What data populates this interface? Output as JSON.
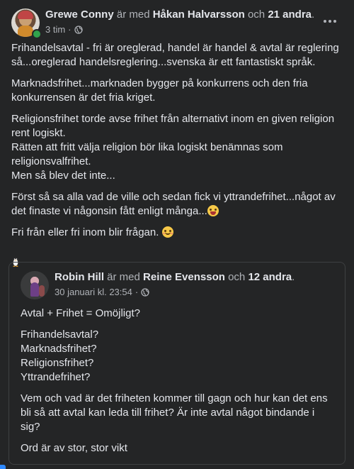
{
  "post": {
    "author": "Grewe Conny",
    "with_text": "är med",
    "tagged": "Håkan Halvarsson",
    "and_text": "och",
    "others": "21 andra",
    "end_period": ".",
    "time": "3 tim",
    "separator": "·",
    "paragraphs": [
      "Frihandelsavtal - fri är oreglerad, handel är handel & avtal är reglering så...oreglerad handelsreglering...svenska är ett fantastiskt språk.",
      "Marknadsfrihet...marknaden bygger på konkurrens och den fria konkurrensen är det fria kriget.",
      "Religionsfrihet torde avse frihet från alternativt inom en given religion rent logiskt.\nRätten att fritt välja religion bör lika logiskt benämnas som religionsvalfrihet.\nMen så blev det inte...",
      "Först så sa alla vad de ville och sedan fick vi yttrandefrihet...något av det finaste vi någonsin fått enligt många...",
      "Fri från eller fri inom blir frågan."
    ]
  },
  "shared": {
    "author": "Robin Hill",
    "with_text": "är med",
    "tagged": "Reine Evensson",
    "and_text": "och",
    "others": "12 andra",
    "end_period": ".",
    "time": "30 januari kl. 23:54",
    "separator": "·",
    "paragraphs": [
      "Avtal + Frihet = Omöjligt?",
      "Frihandelsavtal?\nMarknadsfrihet?\nReligionsfrihet?\nYttrandefrihet?",
      "Vem och vad är det friheten kommer till gagn och hur kan det ens bli så att avtal kan leda till frihet? Är inte avtal något bindande i sig?",
      "Ord är av stor, stor vikt"
    ]
  },
  "icons": {
    "audience": "globe-icon",
    "more": "more-options-icon",
    "emoji_1": "zany-face-emoji",
    "emoji_2": "smiling-face-emoji",
    "extra": "penguin-icon"
  },
  "colors": {
    "background": "#242526",
    "text": "#e4e6eb",
    "secondary_text": "#b0b3b8",
    "border": "#3e4042",
    "online": "#31a24c",
    "accent": "#2d88ff"
  }
}
